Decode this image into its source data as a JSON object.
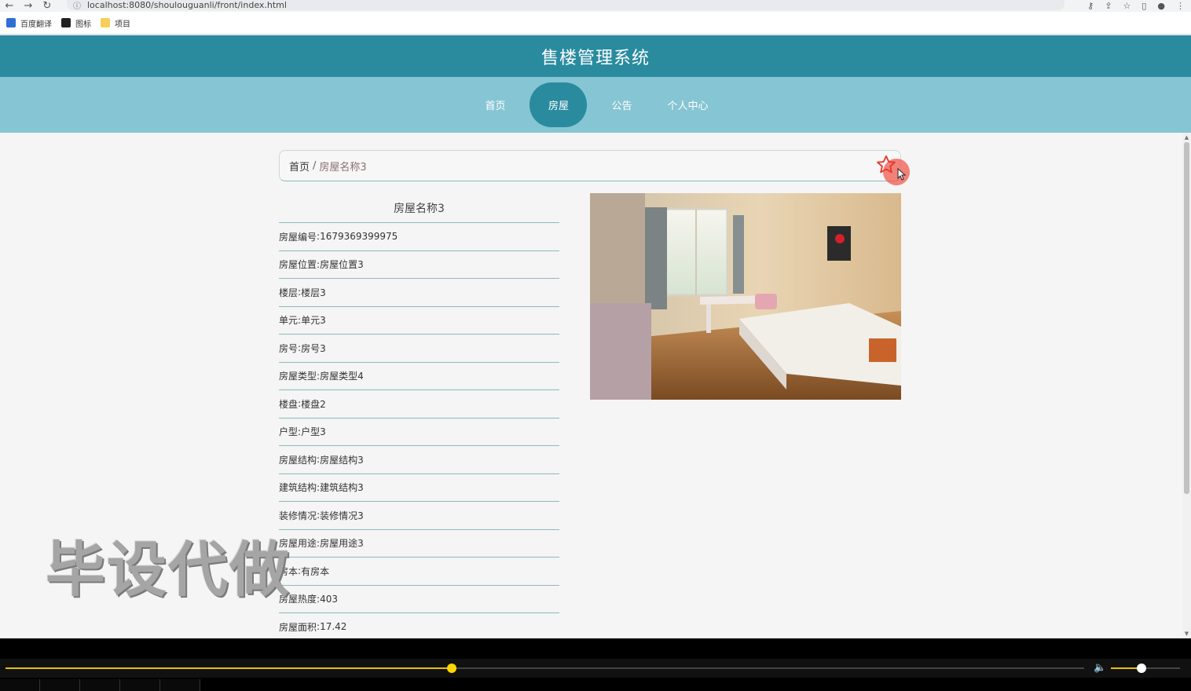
{
  "browser": {
    "url": "localhost:8080/shoulouguanli/front/index.html",
    "bookmarks": [
      {
        "label": "百度翻译"
      },
      {
        "label": "图标"
      },
      {
        "label": "项目"
      }
    ]
  },
  "site": {
    "title": "售楼管理系统",
    "nav": [
      {
        "label": "首页",
        "active": false
      },
      {
        "label": "房屋",
        "active": true
      },
      {
        "label": "公告",
        "active": false
      },
      {
        "label": "个人中心",
        "active": false
      }
    ]
  },
  "breadcrumb": {
    "home": "首页",
    "separator": "/",
    "current": "房屋名称3"
  },
  "detail": {
    "title": "房屋名称3",
    "fields": [
      {
        "label": "房屋编号",
        "value": "1679369399975"
      },
      {
        "label": "房屋位置",
        "value": "房屋位置3"
      },
      {
        "label": "楼层",
        "value": "楼层3"
      },
      {
        "label": "单元",
        "value": "单元3"
      },
      {
        "label": "房号",
        "value": "房号3"
      },
      {
        "label": "房屋类型",
        "value": "房屋类型4"
      },
      {
        "label": "楼盘",
        "value": "楼盘2"
      },
      {
        "label": "户型",
        "value": "户型3"
      },
      {
        "label": "房屋结构",
        "value": "房屋结构3"
      },
      {
        "label": "建筑结构",
        "value": "建筑结构3"
      },
      {
        "label": "装修情况",
        "value": "装修情况3"
      },
      {
        "label": "房屋用途",
        "value": "房屋用途3"
      },
      {
        "label": "房本",
        "value": "有房本"
      },
      {
        "label": "房屋热度",
        "value": "403"
      },
      {
        "label": "房屋面积",
        "value": "17.42"
      }
    ]
  },
  "watermark": "毕设代做",
  "player": {
    "progress_fraction": 0.4134,
    "volume_fraction": 0.44
  },
  "colors": {
    "header": "#2a8b9f",
    "nav": "#86c5d3",
    "divider": "#8fb9c0",
    "favorite": "#f05a50",
    "progress": "#ffd700"
  }
}
